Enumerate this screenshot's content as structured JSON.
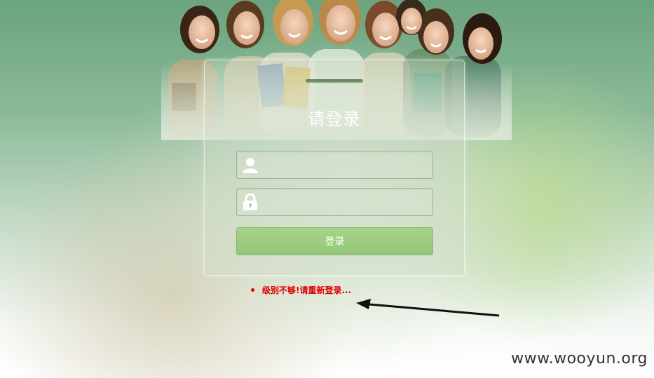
{
  "login": {
    "title": "请登录",
    "username_icon": "user-icon",
    "password_icon": "lock-icon",
    "username_value": "",
    "password_value": "",
    "submit_label": "登录"
  },
  "error": {
    "message": "级别不够!请重新登录..."
  },
  "watermark": "www.wooyun.org",
  "colors": {
    "button": "#9cca7e",
    "error": "#e00000",
    "title": "#ffffff"
  }
}
